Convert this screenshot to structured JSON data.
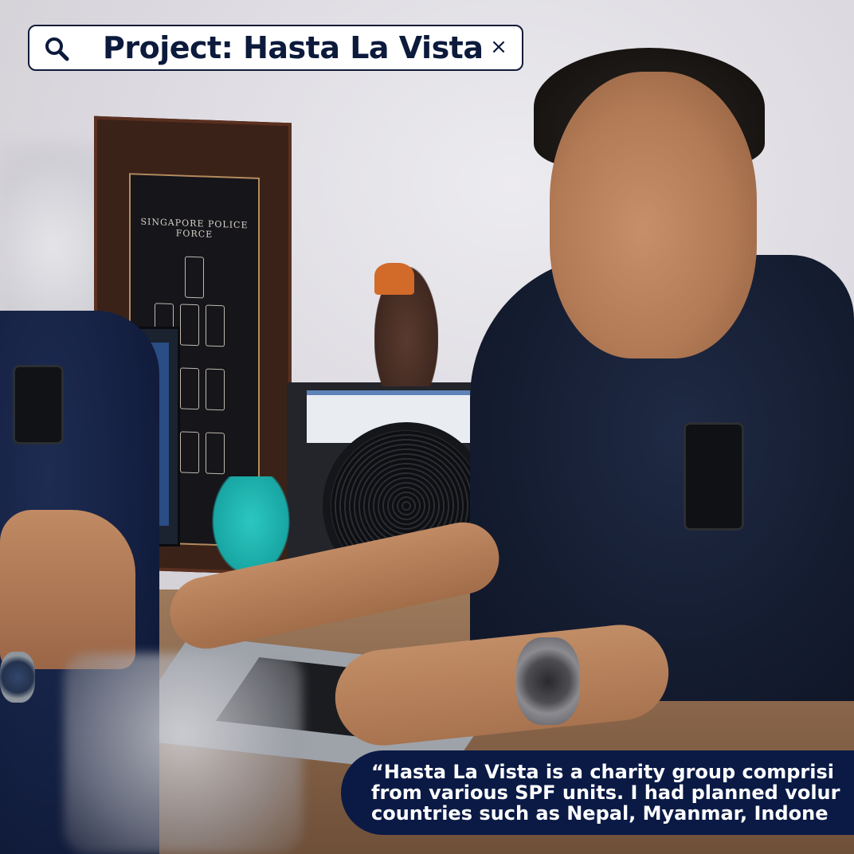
{
  "search": {
    "query": "Project: Hasta La Vista",
    "search_icon": "search-icon",
    "close_icon": "close-icon",
    "close_glyph": "×"
  },
  "frame": {
    "heading": "SINGAPORE POLICE FORCE"
  },
  "quote": {
    "line1": "“Hasta La Vista is a charity group comprisi",
    "line2": "from various SPF units. I had planned volur",
    "line3": "countries such as Nepal, Myanmar, Indone"
  },
  "colors": {
    "navy": "#0a1a45",
    "title_text": "#0c1a3c",
    "search_bg": "#ffffff"
  }
}
